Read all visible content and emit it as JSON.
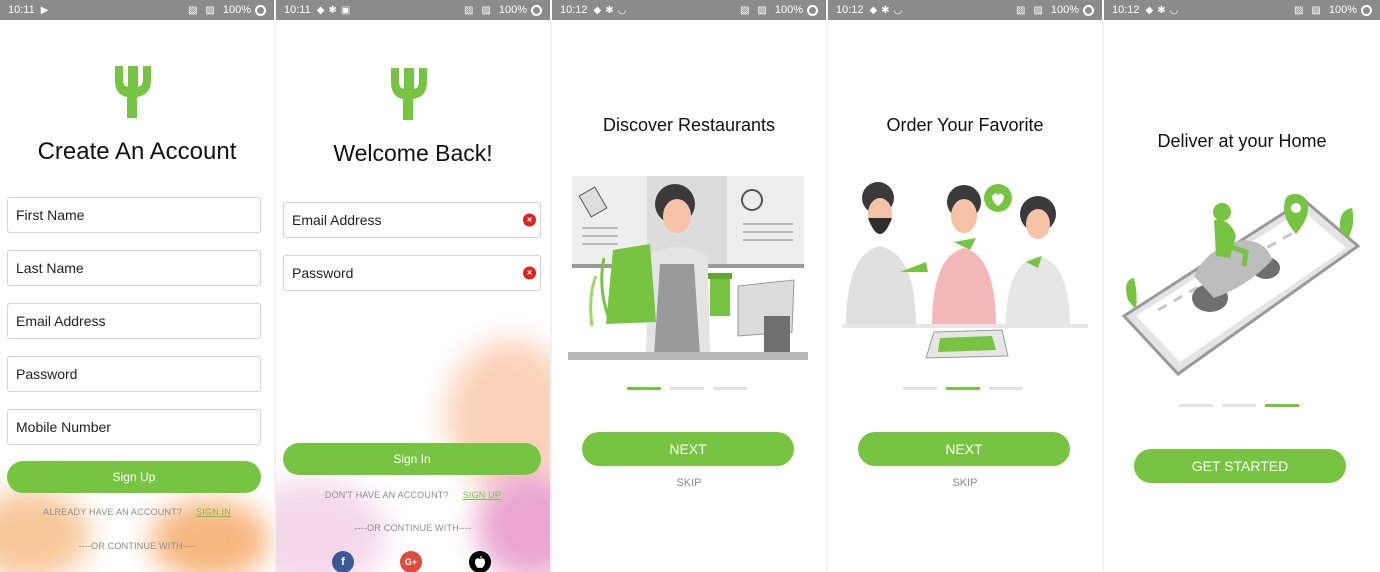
{
  "colors": {
    "accent": "#76c442",
    "statusbar": "#8b8b8b",
    "error": "#e32020",
    "facebook": "#3b5998",
    "google": "#dd4b39",
    "apple": "#000000"
  },
  "screens": [
    {
      "status": {
        "time": "10:11",
        "battery": "100%"
      }
    },
    {
      "status": {
        "time": "10:11",
        "battery": "100%"
      }
    },
    {
      "status": {
        "time": "10:12",
        "battery": "100%"
      }
    },
    {
      "status": {
        "time": "10:12",
        "battery": "100%"
      }
    },
    {
      "status": {
        "time": "10:12",
        "battery": "100%"
      }
    }
  ],
  "signup": {
    "title": "Create An Account",
    "fields": [
      "First Name",
      "Last Name",
      "Email Address",
      "Password",
      "Mobile Number"
    ],
    "button": "Sign Up",
    "prompt": "ALREADY HAVE AN ACCOUNT?",
    "link": "SIGN IN",
    "continue": "----OR CONTINUE WITH----"
  },
  "signin": {
    "title": "Welcome Back!",
    "fields": [
      "Email Address",
      "Password"
    ],
    "button": "Sign In",
    "prompt": "DON'T HAVE AN ACCOUNT?",
    "link": "SIGN UP",
    "continue": "----OR CONTINUE WITH----",
    "social": [
      "f",
      "G+",
      ""
    ]
  },
  "onboarding": [
    {
      "title": "Discover Restaurants",
      "button": "NEXT",
      "skip": "SKIP",
      "active_step": 1
    },
    {
      "title": "Order Your Favorite",
      "button": "NEXT",
      "skip": "SKIP",
      "active_step": 2
    },
    {
      "title": "Deliver at your Home",
      "button": "GET STARTED",
      "active_step": 3
    }
  ]
}
